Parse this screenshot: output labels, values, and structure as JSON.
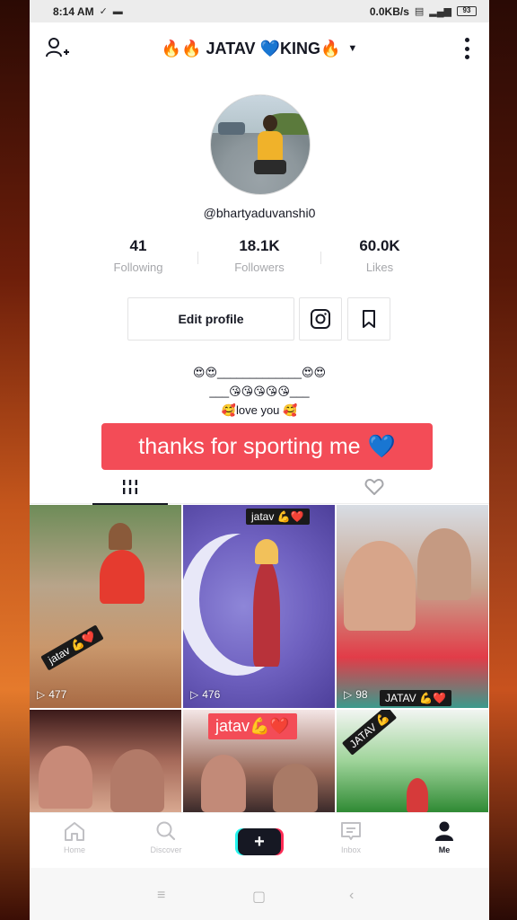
{
  "status_bar": {
    "time": "8:14 AM",
    "network_speed": "0.0KB/s",
    "battery": "93"
  },
  "profile": {
    "display_name": "🔥🔥 JATAV 💙KING🔥",
    "handle": "@bhartyaduvanshi0",
    "stats": [
      {
        "value": "41",
        "label": "Following"
      },
      {
        "value": "18.1K",
        "label": "Followers"
      },
      {
        "value": "60.0K",
        "label": "Likes"
      }
    ],
    "edit_label": "Edit profile",
    "bio_lines": [
      "😍😍_____________😍😍",
      "___😘😘😘😘😘___",
      "🥰love you 🥰"
    ]
  },
  "caption": {
    "text": "thanks for sporting me",
    "emoji": "💙"
  },
  "videos": [
    {
      "views": "477",
      "tag": "jatav 💪❤️"
    },
    {
      "views": "476",
      "tag": "jatav 💪❤️"
    },
    {
      "views": "98",
      "tag": "JATAV 💪❤️"
    },
    {
      "views": "",
      "tag": ""
    },
    {
      "views": "",
      "tag": "jatav💪❤️"
    },
    {
      "views": "",
      "tag": "JATAV 💪"
    }
  ],
  "bottom_nav": [
    {
      "label": "Home",
      "icon": "home-icon"
    },
    {
      "label": "Discover",
      "icon": "search-icon"
    },
    {
      "label": "+",
      "icon": "plus-icon"
    },
    {
      "label": "Inbox",
      "icon": "inbox-icon"
    },
    {
      "label": "Me",
      "icon": "profile-icon"
    }
  ],
  "colors": {
    "accent_red": "#f34c57",
    "text_dark": "#161823",
    "muted": "#a6a7ab"
  }
}
